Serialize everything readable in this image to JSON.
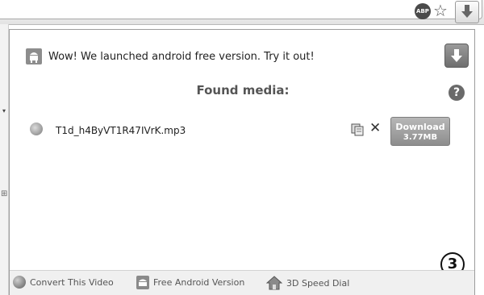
{
  "toolbar": {
    "abp_label": "ABP"
  },
  "popup": {
    "notice": "Wow! We launched android free version. Try it out!",
    "found_media_title": "Found media:",
    "help_label": "?",
    "media": [
      {
        "filename": "T1d_h4ByVT1R47IVrK.mp3",
        "download_label": "Download",
        "size": "3.77MB"
      }
    ],
    "footer": {
      "convert": "Convert This Video",
      "android": "Free Android Version",
      "speed_dial": "3D Speed Dial"
    },
    "badge": "3"
  },
  "icons": [
    "abp-icon",
    "star-icon",
    "download-arrow-icon",
    "android-icon",
    "help-icon",
    "music-file-icon",
    "copy-icon",
    "remove-icon",
    "globe-icon",
    "house-icon"
  ],
  "colors": {
    "popup_bg": "#ffffff",
    "button_gray": "#9e9e9e",
    "footer_bg": "#f0f0f0"
  }
}
